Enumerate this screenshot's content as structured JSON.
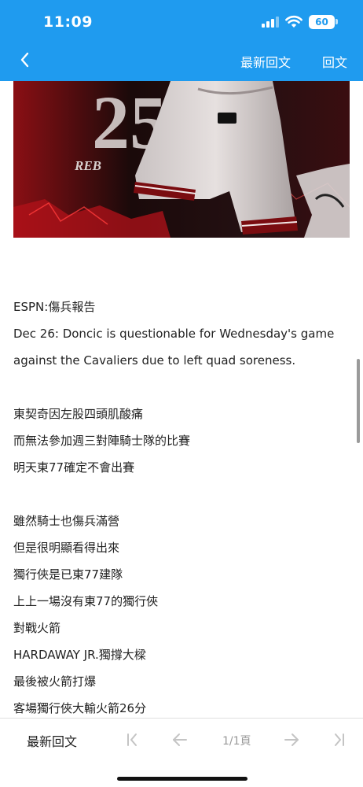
{
  "status": {
    "time": "11:09",
    "battery": "60"
  },
  "nav": {
    "latest_label": "最新回文",
    "reply_label": "回文"
  },
  "hero": {
    "number_text": "25",
    "sub_text": "REB"
  },
  "post": {
    "lines": [
      "ESPN:傷兵報告",
      "Dec 26: Doncic is questionable for Wednesday's game",
      "against the Cavaliers due to left quad soreness.",
      "",
      "東契奇因左股四頭肌酸痛",
      "而無法參加週三對陣騎士隊的比賽",
      "明天東77確定不會出賽",
      "",
      "雖然騎士也傷兵滿營",
      "但是很明顯看得出來",
      "獨行俠是已東77建隊",
      "上上一場沒有東77的獨行俠",
      "對戰火箭",
      "HARDAWAY JR.獨撐大樑",
      "最後被火箭打爆",
      "客場獨行俠大輸火箭26分"
    ]
  },
  "bottombar": {
    "latest_label": "最新回文",
    "page_indicator": "1/1頁"
  },
  "colors": {
    "accent": "#1f9bef"
  },
  "icons": [
    "back-chevron-icon",
    "first-page-icon",
    "prev-page-icon",
    "next-page-icon",
    "last-page-icon"
  ]
}
